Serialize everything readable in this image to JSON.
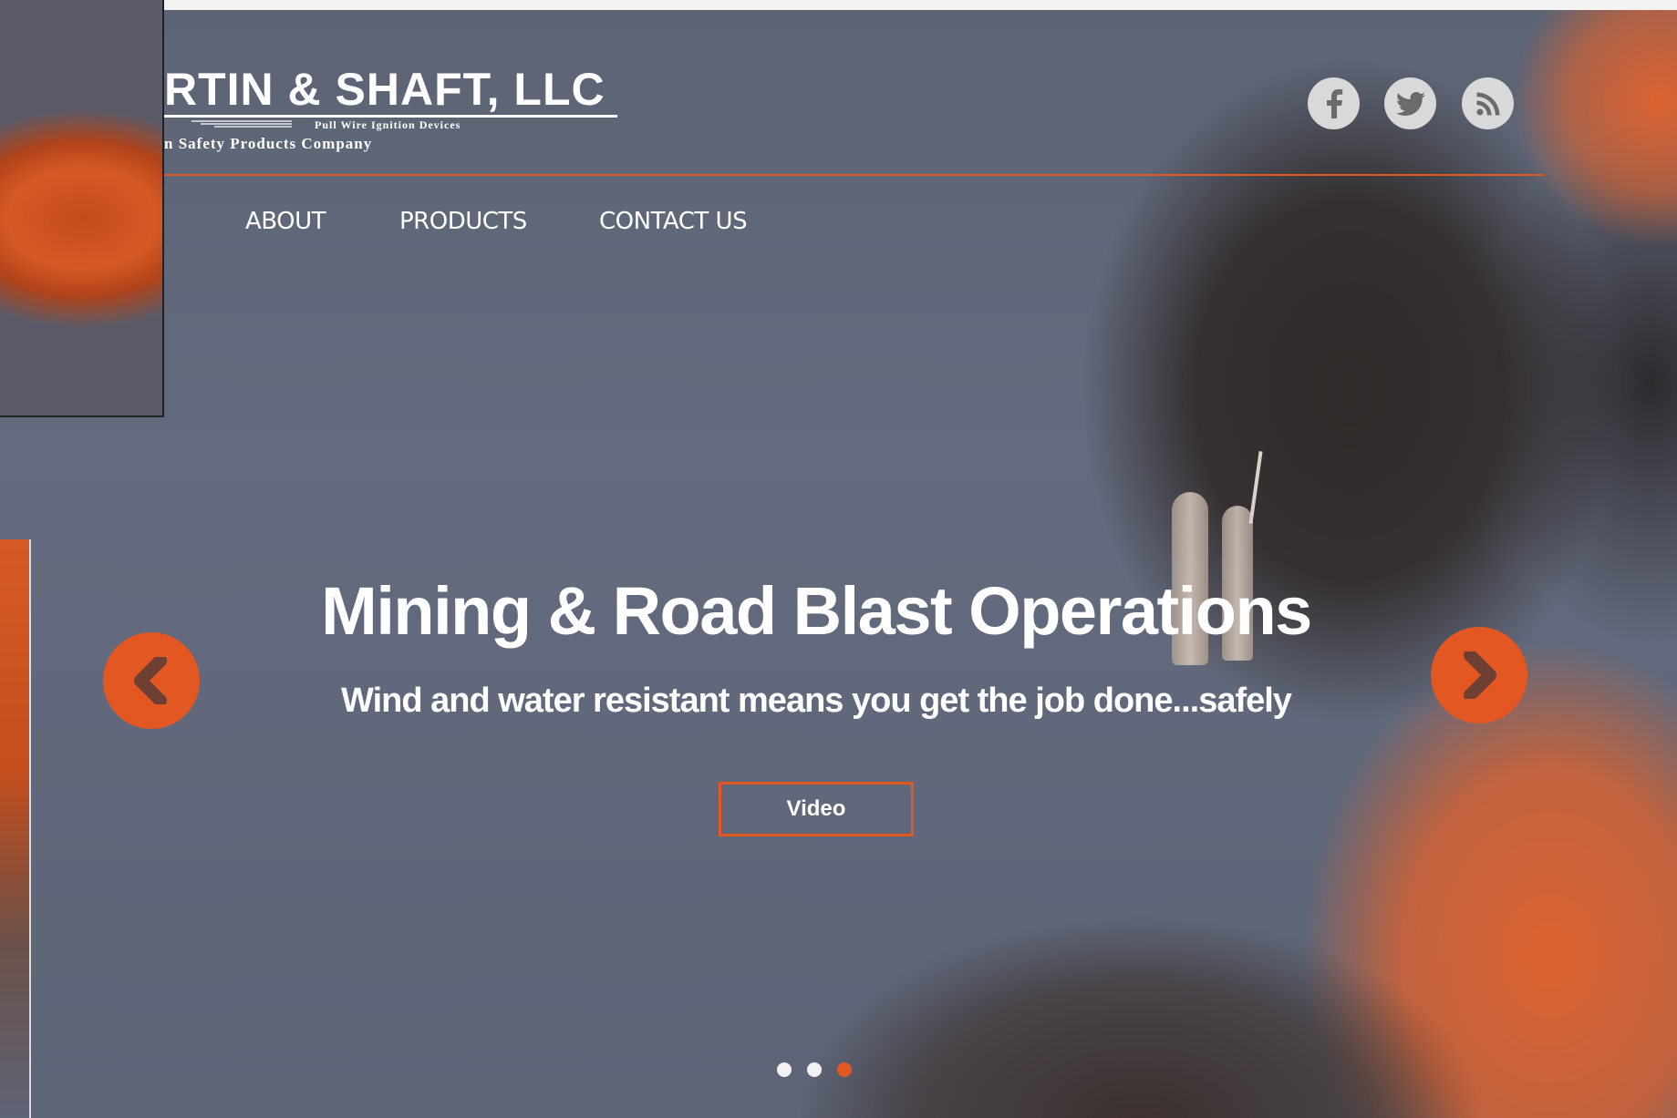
{
  "colors": {
    "accent": "#e35722",
    "text": "#ffffff",
    "social_bg": "#d9d9d9",
    "social_icon": "#6b6b6b"
  },
  "header": {
    "logo": {
      "title": "RTIN & SHAFT, LLC",
      "subtitle": "Pull Wire Ignition Devices",
      "tagline": "n Safety Products Company"
    },
    "social": [
      {
        "name": "facebook",
        "icon": "facebook-icon"
      },
      {
        "name": "twitter",
        "icon": "twitter-icon"
      },
      {
        "name": "rss",
        "icon": "rss-icon"
      }
    ]
  },
  "nav": {
    "items": [
      {
        "label": "ABOUT"
      },
      {
        "label": "PRODUCTS"
      },
      {
        "label": "CONTACT US"
      }
    ]
  },
  "hero": {
    "title": "Mining & Road Blast Operations",
    "subtitle": "Wind and water resistant means you get the job done...safely",
    "button_label": "Video",
    "prev_icon": "chevron-left-icon",
    "next_icon": "chevron-right-icon",
    "slides_total": 3,
    "active_slide": 3
  }
}
